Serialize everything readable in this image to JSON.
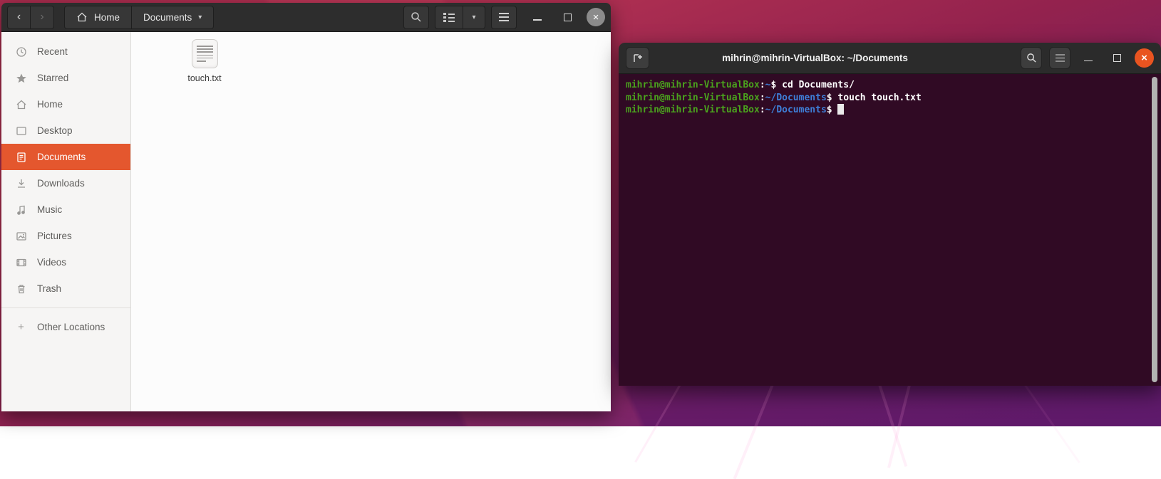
{
  "files": {
    "header": {
      "back_icon": "‹",
      "forward_icon": "›",
      "path": {
        "home_label": "Home",
        "current_label": "Documents",
        "caret_icon": "▾"
      },
      "view_caret_icon": "▾",
      "minimize_icon": "",
      "maximize_icon": "",
      "close_icon": "×"
    },
    "sidebar": {
      "items": [
        {
          "label": "Recent"
        },
        {
          "label": "Starred"
        },
        {
          "label": "Home"
        },
        {
          "label": "Desktop"
        },
        {
          "label": "Documents",
          "selected": true
        },
        {
          "label": "Downloads"
        },
        {
          "label": "Music"
        },
        {
          "label": "Pictures"
        },
        {
          "label": "Videos"
        },
        {
          "label": "Trash"
        }
      ],
      "other_locations": {
        "label": "Other Locations",
        "plus_icon": "+"
      }
    },
    "content": {
      "files": [
        {
          "name": "touch.txt"
        }
      ]
    }
  },
  "terminal": {
    "title": "mihrin@mihrin-VirtualBox: ~/Documents",
    "close_icon": "×",
    "lines": [
      {
        "user": "mihrin@mihrin-VirtualBox",
        "sep": ":",
        "path": "~",
        "prompt": "$ ",
        "command": "cd Documents/"
      },
      {
        "user": "mihrin@mihrin-VirtualBox",
        "sep": ":",
        "path": "~/Documents",
        "prompt": "$ ",
        "command": "touch touch.txt"
      },
      {
        "user": "mihrin@mihrin-VirtualBox",
        "sep": ":",
        "path": "~/Documents",
        "prompt": "$ ",
        "command": ""
      }
    ],
    "colors": {
      "background": "#300a24",
      "user_green": "#4AA21D",
      "path_blue": "#3E7FD8",
      "text": "#ffffff",
      "close_orange": "#E95420"
    }
  },
  "colors": {
    "accent_orange": "#E4572E",
    "wallpaper_top": "#A92C4E",
    "wallpaper_bottom": "#5E1A6B",
    "header_dark": "#2D2D2D"
  }
}
